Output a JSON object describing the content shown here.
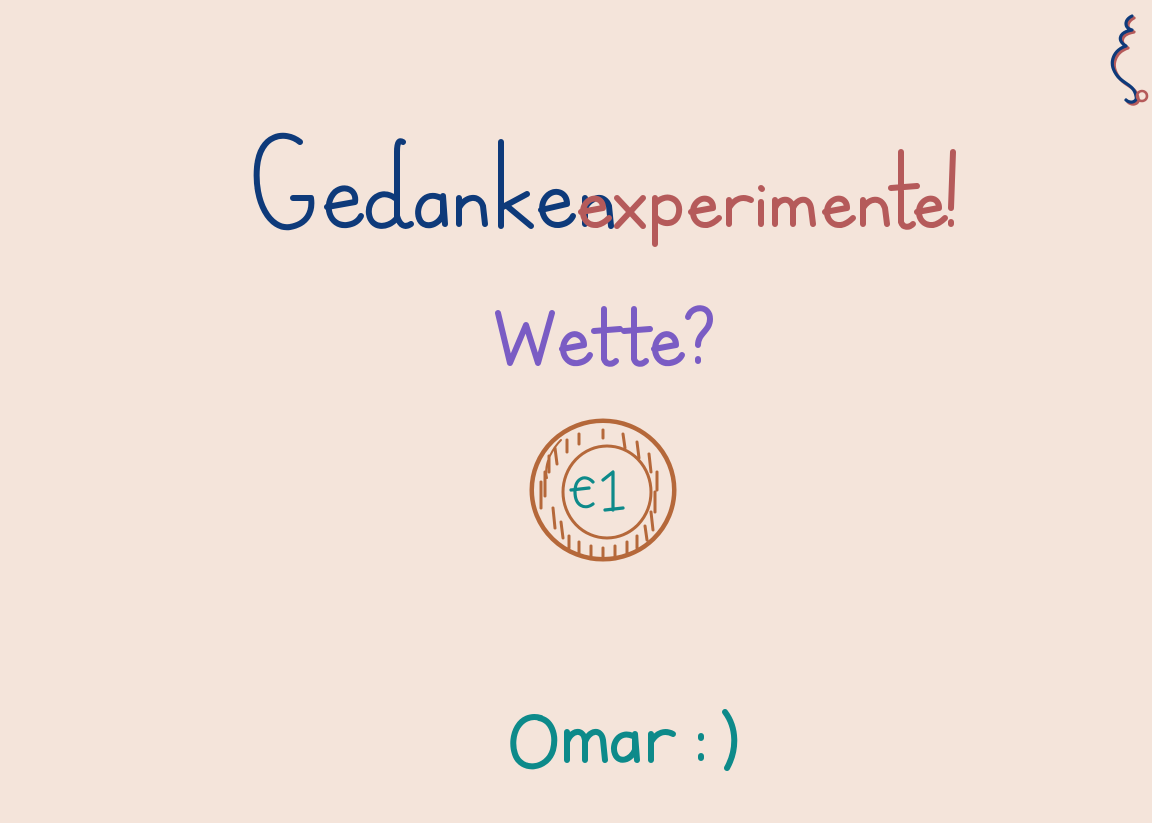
{
  "slide": {
    "title_part1": "Gedanken",
    "title_part2": "experimente!",
    "subtitle": "Wette?",
    "coin_label": "€1",
    "signature": "Omar :)",
    "corner_glyph": "ξ"
  },
  "colors": {
    "background": "#f4e4da",
    "navy": "#0e3a7a",
    "rose": "#b55a5a",
    "purple": "#7a5cc4",
    "coin_brown": "#b5683a",
    "teal": "#0d8a8a"
  },
  "icons": {
    "coin": "euro-coin-icon",
    "chart": "rising-falling-lines-icon"
  }
}
